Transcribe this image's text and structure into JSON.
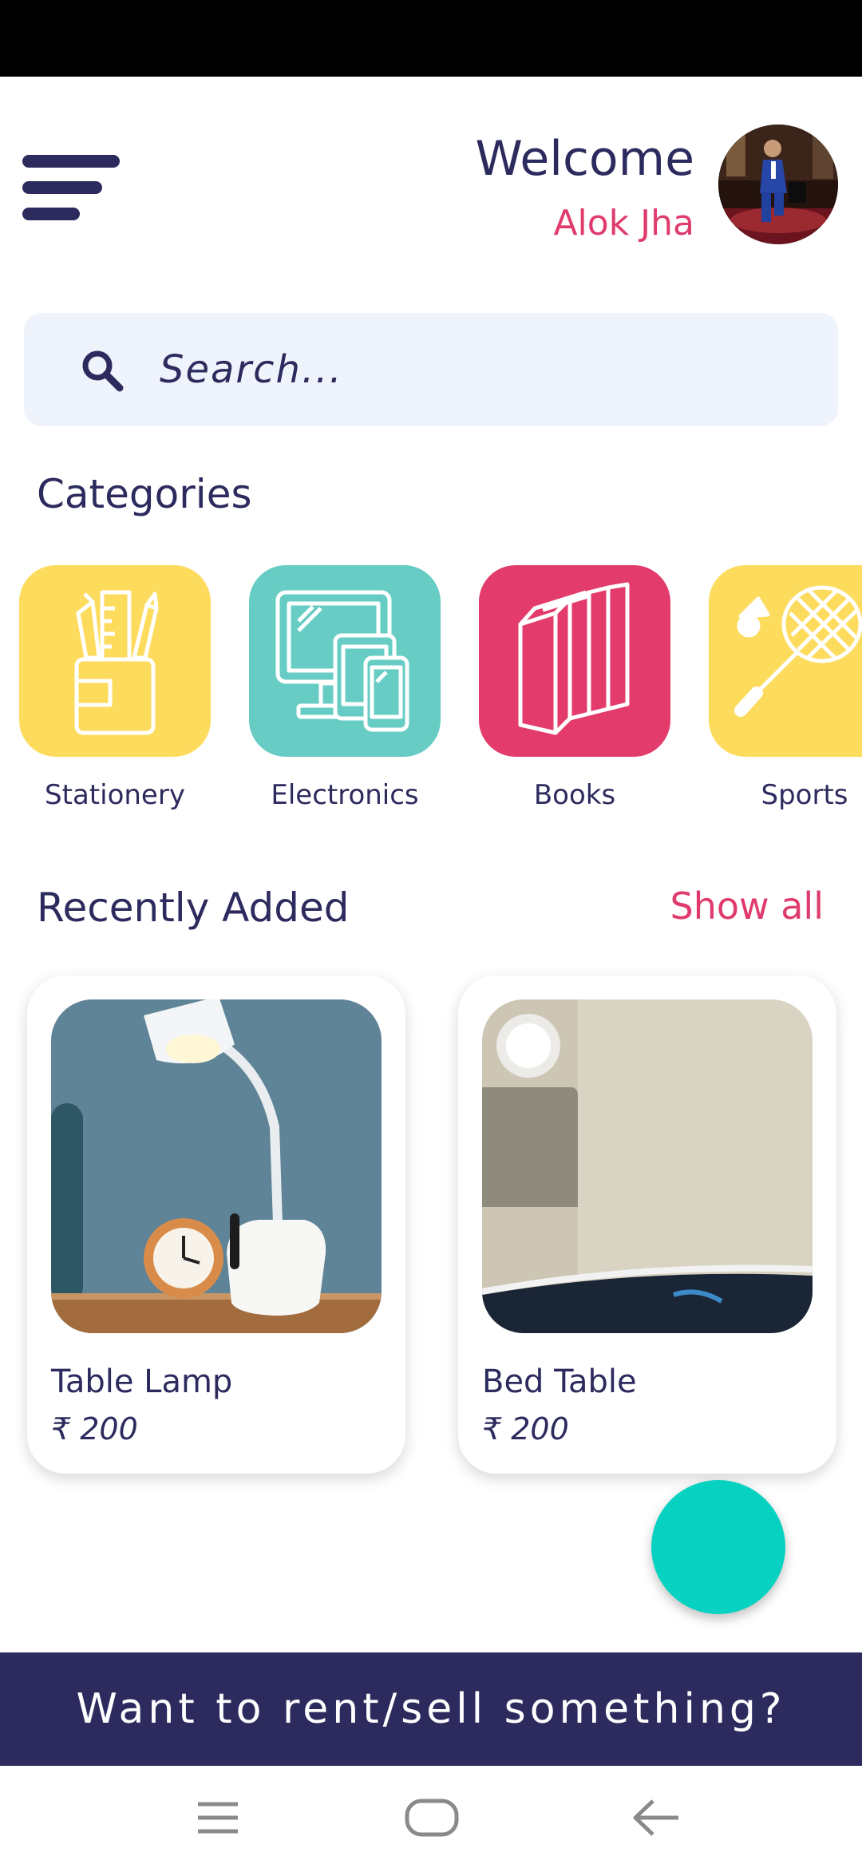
{
  "header": {
    "welcome": "Welcome",
    "username": "Alok Jha"
  },
  "search": {
    "placeholder": "Search..."
  },
  "categories": {
    "title": "Categories",
    "items": [
      {
        "label": "Stationery",
        "color": "#fddb5c",
        "icon": "pencil-holder-icon"
      },
      {
        "label": "Electronics",
        "color": "#67cdc4",
        "icon": "devices-icon"
      },
      {
        "label": "Books",
        "color": "#e33b6c",
        "icon": "books-icon"
      },
      {
        "label": "Sports",
        "color": "#fddb5c",
        "icon": "badminton-icon"
      }
    ]
  },
  "recent": {
    "title": "Recently Added",
    "show_all": "Show all",
    "items": [
      {
        "name": "Table Lamp",
        "price": "₹ 200"
      },
      {
        "name": "Bed Table",
        "price": "₹ 200"
      }
    ]
  },
  "banner": {
    "text": "Want to rent/sell something?"
  },
  "colors": {
    "primary": "#2d2b5e",
    "accent": "#e03b6d",
    "fab": "#07d2c1",
    "search_bg": "#eff3fb"
  }
}
